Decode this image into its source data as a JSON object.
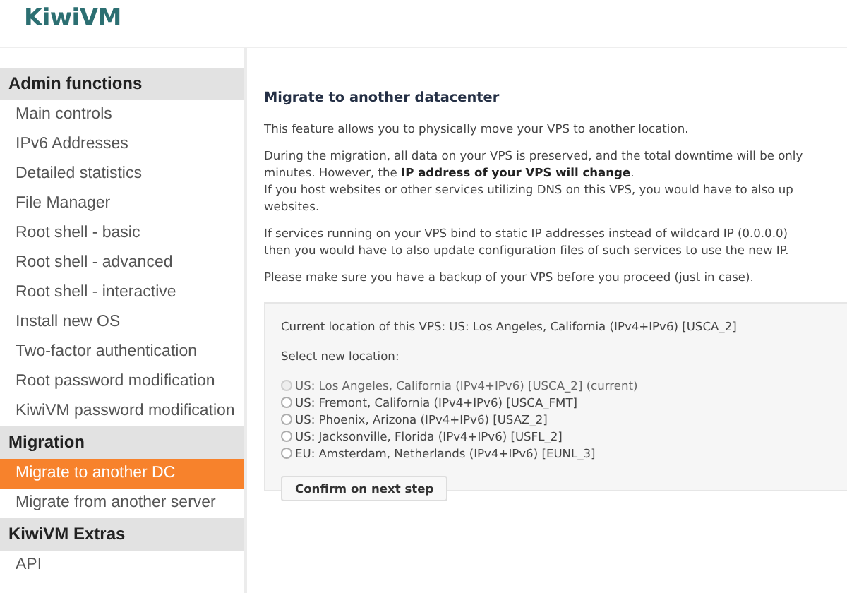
{
  "header": {
    "logo": "KiwiVM"
  },
  "sidebar": [
    {
      "heading": "Admin functions",
      "items": [
        {
          "label": "Main controls",
          "selected": false
        },
        {
          "label": "IPv6 Addresses",
          "selected": false
        },
        {
          "label": "Detailed statistics",
          "selected": false
        },
        {
          "label": "File Manager",
          "selected": false
        },
        {
          "label": "Root shell - basic",
          "selected": false
        },
        {
          "label": "Root shell - advanced",
          "selected": false
        },
        {
          "label": "Root shell - interactive",
          "selected": false
        },
        {
          "label": "Install new OS",
          "selected": false
        },
        {
          "label": "Two-factor authentication",
          "selected": false
        },
        {
          "label": "Root password modification",
          "selected": false
        },
        {
          "label": "KiwiVM password modification",
          "selected": false
        }
      ]
    },
    {
      "heading": "Migration",
      "items": [
        {
          "label": "Migrate to another DC",
          "selected": true
        },
        {
          "label": "Migrate from another server",
          "selected": false
        }
      ]
    },
    {
      "heading": "KiwiVM Extras",
      "items": [
        {
          "label": "API",
          "selected": false
        }
      ]
    }
  ],
  "main": {
    "title": "Migrate to another datacenter",
    "paragraphs": [
      [
        "This feature allows you to physically move your VPS to another location."
      ],
      [
        "During the migration, all data on your VPS is preserved, and the total downtime will be only",
        "minutes. However, the **IP address of your VPS will change**.",
        "If you host websites or other services utilizing DNS on this VPS, you would have to also up",
        "websites."
      ],
      [
        "If services running on your VPS bind to static IP addresses instead of wildcard IP (0.0.0.0)",
        "then you would have to also update configuration files of such services to use the new IP."
      ],
      [
        "Please make sure you have a backup of your VPS before you proceed (just in case)."
      ]
    ],
    "form": {
      "current_location": "Current location of this VPS: US: Los Angeles, California (IPv4+IPv6) [USCA_2]",
      "select_label": "Select new location:",
      "options": [
        {
          "label": "US: Los Angeles, California (IPv4+IPv6) [USCA_2] (current)",
          "selected": false,
          "disabled": true
        },
        {
          "label": "US: Fremont, California (IPv4+IPv6) [USCA_FMT]",
          "selected": false,
          "disabled": false
        },
        {
          "label": "US: Phoenix, Arizona (IPv4+IPv6) [USAZ_2]",
          "selected": false,
          "disabled": false
        },
        {
          "label": "US: Jacksonville, Florida (IPv4+IPv6) [USFL_2]",
          "selected": false,
          "disabled": false
        },
        {
          "label": "EU: Amsterdam, Netherlands (IPv4+IPv6) [EUNL_3]",
          "selected": false,
          "disabled": false
        }
      ],
      "button": "Confirm on next step"
    }
  }
}
